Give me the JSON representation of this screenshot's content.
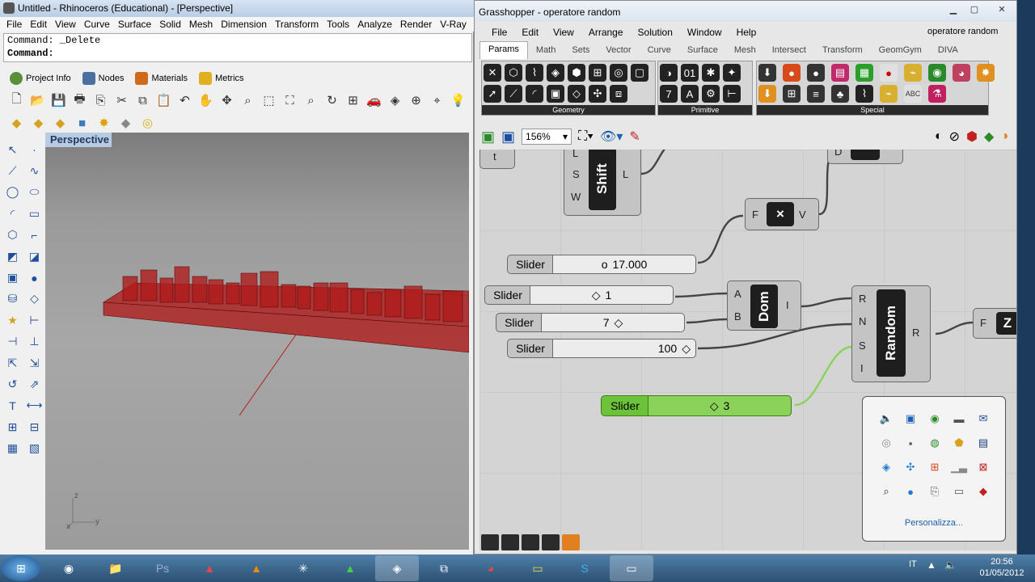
{
  "rhino": {
    "title": "Untitled - Rhinoceros (Educational) - [Perspective]",
    "menu": [
      "File",
      "Edit",
      "View",
      "Curve",
      "Surface",
      "Solid",
      "Mesh",
      "Dimension",
      "Transform",
      "Tools",
      "Analyze",
      "Render",
      "V-Ray"
    ],
    "command_history": "Command: _Delete",
    "command_prompt": "Command:",
    "panel_tabs": [
      "Project Info",
      "Nodes",
      "Materials",
      "Metrics"
    ],
    "viewport_label": "Perspective",
    "axis_z": "z",
    "axis_x": "x",
    "axis_y": "y"
  },
  "grasshopper": {
    "title": "Grasshopper - operatore random",
    "menu": [
      "File",
      "Edit",
      "View",
      "Arrange",
      "Solution",
      "Window",
      "Help"
    ],
    "doc_name": "operatore random",
    "tabs": [
      "Params",
      "Math",
      "Sets",
      "Vector",
      "Curve",
      "Surface",
      "Mesh",
      "Intersect",
      "Transform",
      "GeomGym",
      "DIVA"
    ],
    "active_tab": "Params",
    "ribbon_groups": [
      "Geometry",
      "Primitive",
      "Special"
    ],
    "zoom": "156%",
    "components": {
      "shift": {
        "name": "Shift",
        "inputs": [
          "L",
          "S",
          "W"
        ],
        "outputs": [
          "L"
        ]
      },
      "multiply": {
        "name": "×",
        "inputs": [
          "F"
        ],
        "outputs": [
          "V"
        ]
      },
      "dom": {
        "name": "Dom",
        "inputs": [
          "A",
          "B"
        ],
        "outputs": [
          "I"
        ]
      },
      "random": {
        "name": "Random",
        "inputs": [
          "R",
          "N",
          "S",
          "I"
        ],
        "outputs": [
          "R"
        ]
      },
      "partial_right": {
        "input": "F",
        "name": "Z"
      },
      "partial_top_left": {
        "name": "t"
      },
      "partial_top_right": {
        "input": "D"
      }
    },
    "sliders": [
      {
        "label": "Slider",
        "value": "17.000",
        "marker": "o"
      },
      {
        "label": "Slider",
        "value": "1",
        "marker": "◇"
      },
      {
        "label": "Slider",
        "value": "7",
        "marker": "◇"
      },
      {
        "label": "Slider",
        "value": "100",
        "marker": "◇"
      },
      {
        "label": "Slider",
        "value": "3",
        "marker": "◇"
      }
    ]
  },
  "tray": {
    "link": "Personalizza..."
  },
  "taskbar": {
    "lang": "IT",
    "time": "20:56",
    "date": "01/05/2012"
  },
  "colors": {
    "boxes": "#b01a1a",
    "slider_green": "#6cc33a",
    "component_gray": "#c4c4c4",
    "taskbar": "#2c5173"
  }
}
